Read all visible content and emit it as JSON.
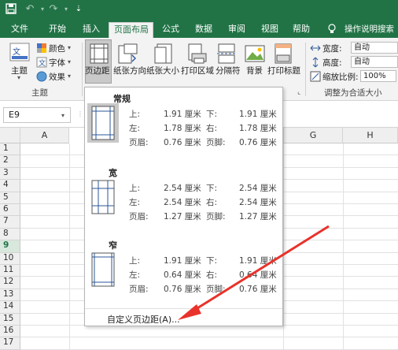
{
  "ribbon_tabs": [
    {
      "label": "文件"
    },
    {
      "label": "开始"
    },
    {
      "label": "插入"
    },
    {
      "label": "页面布局"
    },
    {
      "label": "公式"
    },
    {
      "label": "数据"
    },
    {
      "label": "审阅"
    },
    {
      "label": "视图"
    },
    {
      "label": "帮助"
    },
    {
      "label": "操作说明搜索"
    }
  ],
  "active_tab": "页面布局",
  "theme_group": {
    "themes_label": "主题",
    "colors_label": "颜色",
    "fonts_label": "字体",
    "effects_label": "效果",
    "group_label": "主题"
  },
  "page_setup": {
    "margins": "页边距",
    "orientation": "纸张方向",
    "size": "纸张大小",
    "print_area": "打印区域",
    "breaks": "分隔符",
    "background": "背景",
    "print_titles": "打印标题"
  },
  "scale_group": {
    "width_label": "宽度:",
    "width_value": "自动",
    "height_label": "高度:",
    "height_value": "自动",
    "scale_label": "缩放比例:",
    "scale_value": "100%",
    "group_label": "调整为合适大小"
  },
  "name_box": "E9",
  "columns": [
    "A",
    "G",
    "H"
  ],
  "rows": [
    "1",
    "2",
    "3",
    "4",
    "5",
    "6",
    "7",
    "8",
    "9",
    "10",
    "11",
    "12",
    "13",
    "14",
    "15",
    "16",
    "17"
  ],
  "selected_row": "9",
  "margin_presets": [
    {
      "name": "常规",
      "top_label": "上:",
      "top": "1.91 厘米",
      "bottom_label": "下:",
      "bottom": "1.91 厘米",
      "left_label": "左:",
      "left": "1.78 厘米",
      "right_label": "右:",
      "right": "1.78 厘米",
      "header_label": "页眉:",
      "header": "0.76 厘米",
      "footer_label": "页脚:",
      "footer": "0.76 厘米"
    },
    {
      "name": "宽",
      "top_label": "上:",
      "top": "2.54 厘米",
      "bottom_label": "下:",
      "bottom": "2.54 厘米",
      "left_label": "左:",
      "left": "2.54 厘米",
      "right_label": "右:",
      "right": "2.54 厘米",
      "header_label": "页眉:",
      "header": "1.27 厘米",
      "footer_label": "页脚:",
      "footer": "1.27 厘米"
    },
    {
      "name": "窄",
      "top_label": "上:",
      "top": "1.91 厘米",
      "bottom_label": "下:",
      "bottom": "1.91 厘米",
      "left_label": "左:",
      "left": "0.64 厘米",
      "right_label": "右:",
      "right": "0.64 厘米",
      "header_label": "页眉:",
      "header": "0.76 厘米",
      "footer_label": "页脚:",
      "footer": "0.76 厘米"
    }
  ],
  "custom_margins": "自定义页边距(A)...",
  "colors": {
    "excel_green": "#217346",
    "annotation_arrow": "#e8322b"
  }
}
